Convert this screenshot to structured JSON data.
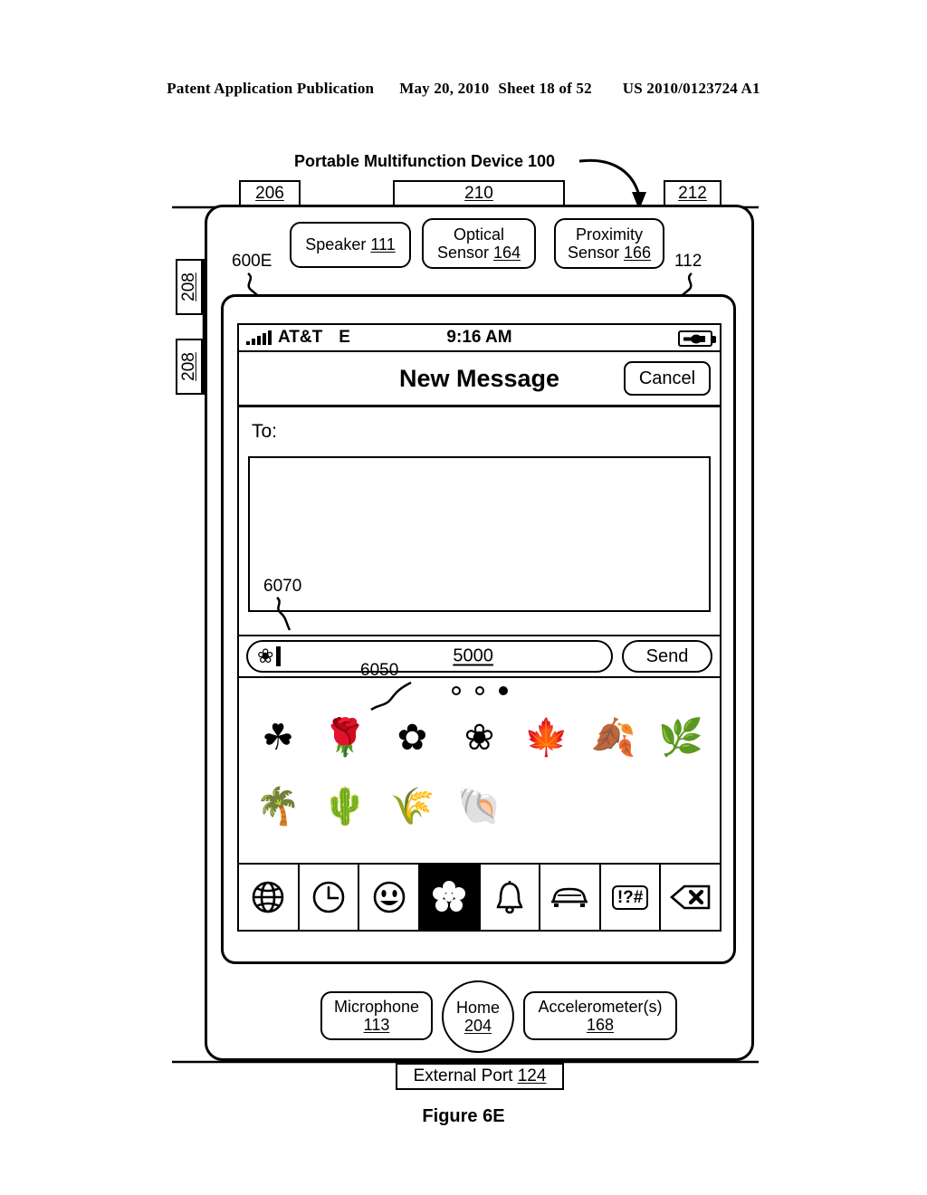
{
  "publication_header": {
    "left": "Patent Application Publication",
    "date": "May 20, 2010",
    "sheet": "Sheet 18 of 52",
    "number": "US 2010/0123724 A1"
  },
  "figure_caption": "Figure 6E",
  "device": {
    "title": "Portable Multifunction Device 100",
    "figure_ref": "600E",
    "screen_ref": "112",
    "top_callouts": [
      {
        "name": "speaker-port-callout",
        "ref": "206"
      },
      {
        "name": "top-edge-callout",
        "ref": "210"
      },
      {
        "name": "right-edge-callout",
        "ref": "212"
      }
    ],
    "side_callouts": [
      {
        "name": "volume-button-callout",
        "ref": "208"
      },
      {
        "name": "volume-button-callout-2",
        "ref": "208"
      }
    ],
    "components": [
      {
        "name": "speaker",
        "label": "Speaker",
        "ref": "111"
      },
      {
        "name": "optical-sensor",
        "label": "Optical Sensor",
        "line1": "Optical",
        "line2": "Sensor",
        "ref": "164"
      },
      {
        "name": "proximity-sensor",
        "label": "Proximity Sensor",
        "line1": "Proximity",
        "line2": "Sensor",
        "ref": "166"
      },
      {
        "name": "microphone",
        "label": "Microphone",
        "ref": "113"
      },
      {
        "name": "home-button",
        "label": "Home",
        "ref": "204"
      },
      {
        "name": "accelerometers",
        "label": "Accelerometer(s)",
        "ref": "168"
      },
      {
        "name": "external-port",
        "label": "External Port",
        "ref": "124"
      }
    ]
  },
  "screen": {
    "status_bar": {
      "signal_bars": 5,
      "carrier": "AT&T",
      "network": "E",
      "time": "9:16 AM",
      "battery_icon": "battery-charging-icon"
    },
    "nav_bar": {
      "title": "New Message",
      "cancel_label": "Cancel"
    },
    "compose": {
      "to_label": "To:",
      "recipients_value": "",
      "input_ref": "6070",
      "input_emoji": "rose-emoji",
      "input_emoji_glyph": "❀",
      "message_value": "",
      "message_ref": "5000",
      "send_label": "Send"
    },
    "emoji_keyboard": {
      "panel_ref": "6050",
      "page_dots": {
        "count": 3,
        "active_index": 2
      },
      "emoji": [
        {
          "name": "four-leaf-clover-emoji",
          "glyph": "☘"
        },
        {
          "name": "rose-emoji",
          "glyph": "🌹"
        },
        {
          "name": "sunflower-emoji",
          "glyph": "✿"
        },
        {
          "name": "hibiscus-emoji",
          "glyph": "❀"
        },
        {
          "name": "maple-leaf-emoji",
          "glyph": "🍁"
        },
        {
          "name": "fallen-leaves-emoji",
          "glyph": "🍂"
        },
        {
          "name": "herb-leaf-emoji",
          "glyph": "🌿"
        },
        {
          "name": "palm-tree-emoji",
          "glyph": "🌴"
        },
        {
          "name": "cactus-emoji",
          "glyph": "🌵"
        },
        {
          "name": "rice-plant-emoji",
          "glyph": "🌾"
        },
        {
          "name": "shell-emoji",
          "glyph": "🐚"
        }
      ],
      "tabs": [
        {
          "name": "tab-globe",
          "icon": "globe-icon",
          "selected": false
        },
        {
          "name": "tab-recent",
          "icon": "clock-icon",
          "selected": false
        },
        {
          "name": "tab-smileys",
          "icon": "smiley-icon",
          "selected": false
        },
        {
          "name": "tab-nature",
          "icon": "flower-icon",
          "selected": true
        },
        {
          "name": "tab-objects",
          "icon": "bell-icon",
          "selected": false
        },
        {
          "name": "tab-vehicles",
          "icon": "car-icon",
          "selected": false
        },
        {
          "name": "tab-symbols",
          "icon": "symbols-icon",
          "selected": false,
          "label": "!?#"
        },
        {
          "name": "tab-delete",
          "icon": "backspace-icon",
          "selected": false
        }
      ]
    }
  },
  "colors": {
    "ink": "#000000",
    "paper": "#ffffff",
    "selected_tab_bg": "#000000"
  }
}
